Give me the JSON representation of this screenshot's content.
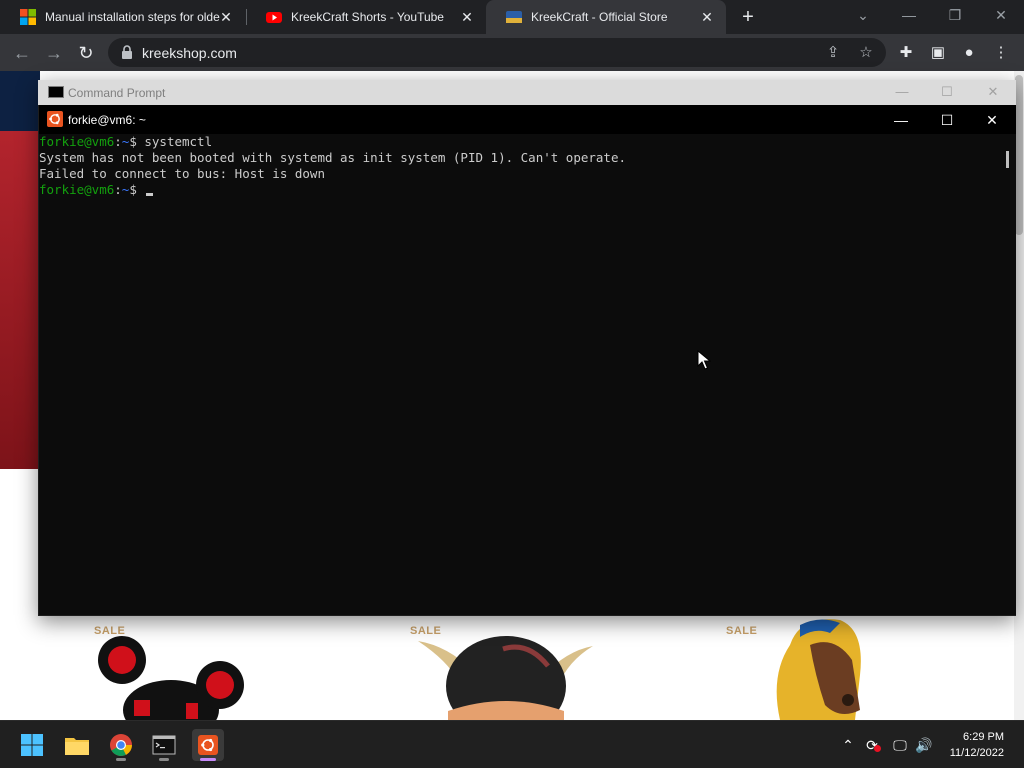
{
  "browser": {
    "tabs": [
      {
        "title": "Manual installation steps for olde",
        "icon": "microsoft-icon"
      },
      {
        "title": "KreekCraft Shorts - YouTube",
        "icon": "youtube-icon"
      },
      {
        "title": "KreekCraft - Official Store",
        "icon": "store-icon",
        "active": true
      }
    ],
    "url": "kreekshop.com"
  },
  "page": {
    "sale_labels": [
      "SALE",
      "SALE",
      "SALE"
    ]
  },
  "cmd_outer": {
    "title": "Command Prompt"
  },
  "terminal": {
    "title": "forkie@vm6: ~",
    "lines": {
      "l1_user": "forkie@vm6",
      "l1_colon": ":",
      "l1_path": "~",
      "l1_cmd": "$ systemctl",
      "l2": "System has not been booted with systemd as init system (PID 1). Can't operate.",
      "l3": "Failed to connect to bus: Host is down",
      "l4_user": "forkie@vm6",
      "l4_colon": ":",
      "l4_path": "~",
      "l4_cmd": "$ "
    }
  },
  "taskbar": {
    "apps": [
      "start-icon",
      "file-explorer-icon",
      "chrome-icon",
      "terminal-icon",
      "ubuntu-icon"
    ],
    "time": "6:29 PM",
    "date": "11/12/2022"
  },
  "colors": {
    "prompt_green": "#13a10e",
    "path_blue": "#3b78ff",
    "ubuntu_orange": "#e95420",
    "chrome_bg": "#202124"
  }
}
